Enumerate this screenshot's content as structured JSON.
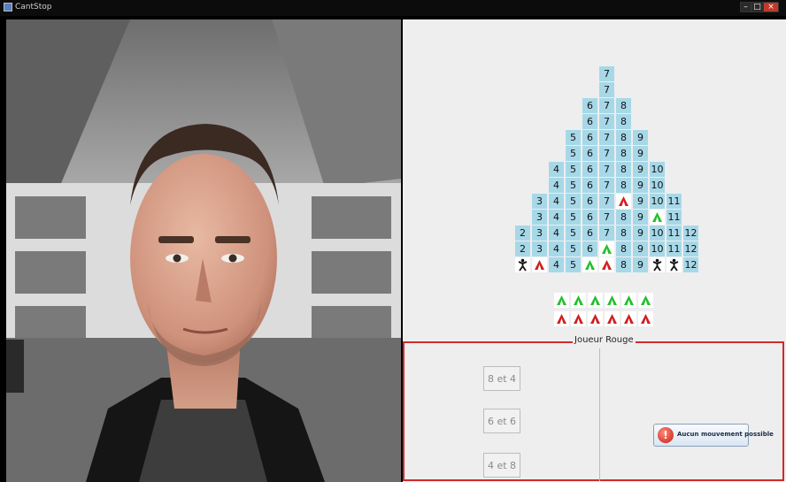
{
  "window": {
    "title": "CantStop",
    "controls": [
      "–",
      "□",
      "×"
    ]
  },
  "board": {
    "rows": [
      [
        "7"
      ],
      [
        "7"
      ],
      [
        "6",
        "7",
        "8"
      ],
      [
        "6",
        "7",
        "8"
      ],
      [
        "5",
        "6",
        "7",
        "8",
        "9"
      ],
      [
        "5",
        "6",
        "7",
        "8",
        "9"
      ],
      [
        "4",
        "5",
        "6",
        "7",
        "8",
        "9",
        "10"
      ],
      [
        "4",
        "5",
        "6",
        "7",
        "8",
        "9",
        "10"
      ],
      [
        "3",
        "4",
        "5",
        "6",
        "7",
        "red-tent",
        "9",
        "10",
        "11"
      ],
      [
        "3",
        "4",
        "5",
        "6",
        "7",
        "8",
        "9",
        "green-tent",
        "11"
      ],
      [
        "2",
        "3",
        "4",
        "5",
        "6",
        "7",
        "8",
        "9",
        "10",
        "11",
        "12"
      ],
      [
        "2",
        "3",
        "4",
        "5",
        "6",
        "green-tent",
        "8",
        "9",
        "10",
        "11",
        "12"
      ],
      [
        "climber",
        "red-tent",
        "4",
        "5",
        "green-tent",
        "red-tent",
        "8",
        "9",
        "climber",
        "climber",
        "12"
      ]
    ]
  },
  "markers": {
    "green_row": [
      "green-tent",
      "green-tent",
      "green-tent",
      "green-tent",
      "green-tent",
      "green-tent"
    ],
    "red_row": [
      "red-tent",
      "red-tent",
      "red-tent",
      "red-tent",
      "red-tent",
      "red-tent"
    ]
  },
  "player_panel": {
    "title": "Joueur Rouge",
    "choices": [
      "8 et 4",
      "6 et 6",
      "4 et 8"
    ],
    "no_move_label": "Aucun mouvement possible"
  },
  "colors": {
    "board_cell": "#a7d8e8",
    "green_tent": "#22c02a",
    "red_tent": "#d21e1e",
    "frame_border": "#d02a2a"
  }
}
